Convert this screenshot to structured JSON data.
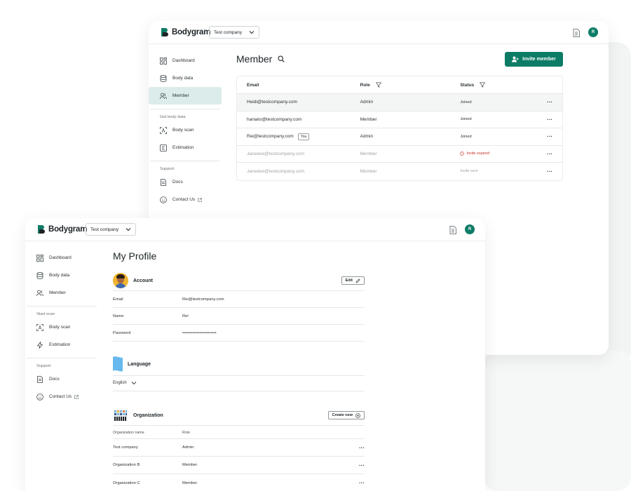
{
  "brand": {
    "name": "Bodygram",
    "accent": "#0d7c66"
  },
  "back_window": {
    "company": "Test company",
    "avatar_initial": "R",
    "sidebar": {
      "items": [
        {
          "label": "Dashboard",
          "icon": "dashboard-icon"
        },
        {
          "label": "Body data",
          "icon": "database-icon"
        },
        {
          "label": "Member",
          "icon": "users-icon",
          "active": true
        }
      ],
      "section_get": "Get body data",
      "get_items": [
        {
          "label": "Body scan",
          "icon": "scan-icon"
        },
        {
          "label": "Estimation",
          "icon": "estimation-icon"
        }
      ],
      "section_support": "Support",
      "support_items": [
        {
          "label": "Docs",
          "icon": "docs-icon"
        },
        {
          "label": "Contact Us",
          "icon": "smile-icon"
        }
      ]
    },
    "title": "Member",
    "invite_label": "Invite member",
    "table": {
      "headers": {
        "email": "Email",
        "role": "Role",
        "status": "Status"
      },
      "rows": [
        {
          "email": "Heidi@testcompany.com",
          "role": "Admin",
          "status": "Joined"
        },
        {
          "email": "hanako@testcompany.com",
          "role": "Member",
          "status": "Joined"
        },
        {
          "email": "Rei@testcompany.com",
          "badge": "You",
          "role": "Admin",
          "status": "Joined"
        },
        {
          "email": "Janedoe@testcompany.com",
          "role": "Member",
          "status": "Invite expired"
        },
        {
          "email": "Janedoe@testcompany.com",
          "role": "Member",
          "status": "Invite sent"
        }
      ],
      "more": "···"
    }
  },
  "front_window": {
    "company": "Test company",
    "avatar_initial": "R",
    "sidebar": {
      "items": [
        {
          "label": "Dashboard",
          "icon": "dashboard-icon"
        },
        {
          "label": "Body data",
          "icon": "database-icon"
        },
        {
          "label": "Member",
          "icon": "users-icon"
        }
      ],
      "section_start": "Start scan",
      "start_items": [
        {
          "label": "Body scan",
          "icon": "scan-icon"
        },
        {
          "label": "Estimation",
          "icon": "lightning-icon"
        }
      ],
      "section_support": "Support",
      "support_items": [
        {
          "label": "Docs",
          "icon": "docs-icon"
        },
        {
          "label": "Contact Us",
          "icon": "smile-icon"
        }
      ]
    },
    "title": "My Profile",
    "account": {
      "heading": "Account",
      "edit_label": "Edit",
      "fields": [
        {
          "key": "Email",
          "value": "Rei@testcompany.com"
        },
        {
          "key": "Name",
          "value": "Rei"
        },
        {
          "key": "Password",
          "value": "••••••••••••••••••••••••"
        }
      ]
    },
    "language": {
      "heading": "Language",
      "value": "English"
    },
    "organization": {
      "heading": "Organization",
      "create_label": "Create new",
      "headers": {
        "name": "Organization name",
        "role": "Role"
      },
      "rows": [
        {
          "name": "Test company",
          "role": "Admin"
        },
        {
          "name": "Organization B",
          "role": "Member"
        },
        {
          "name": "Organization C",
          "role": "Member"
        }
      ],
      "more": "···"
    }
  }
}
